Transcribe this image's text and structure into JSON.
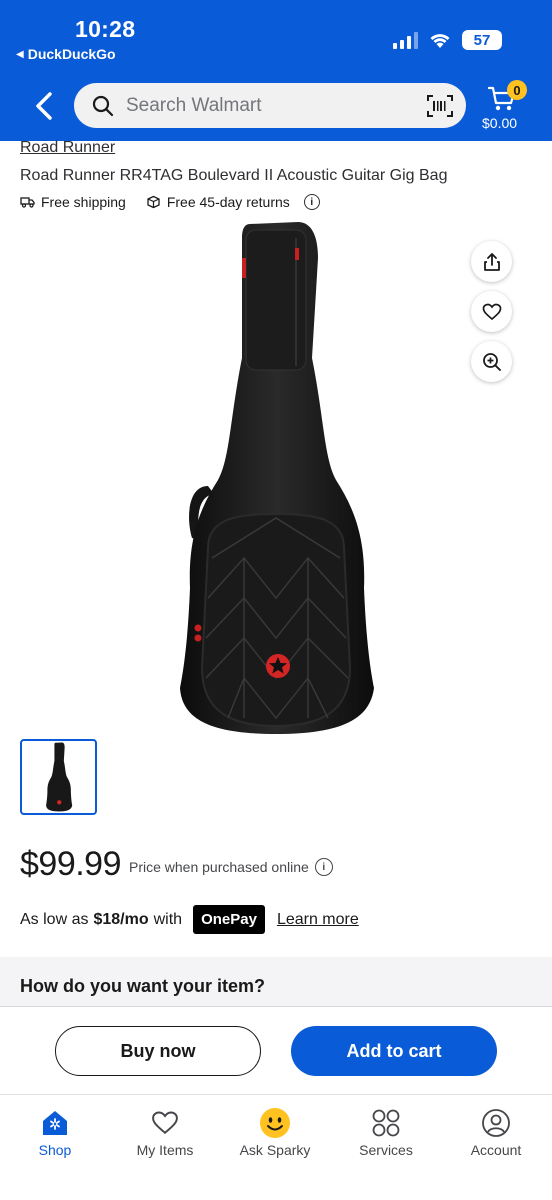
{
  "status_bar": {
    "time": "10:28",
    "back_app": "DuckDuckGo",
    "battery": "57"
  },
  "header": {
    "search_placeholder": "Search Walmart",
    "cart_count": "0",
    "cart_total": "$0.00"
  },
  "product": {
    "brand": "Road Runner",
    "title": "Road Runner RR4TAG Boulevard II Acoustic Guitar Gig Bag",
    "perks": [
      "Free shipping",
      "Free 45-day returns"
    ],
    "price": "$99.99",
    "price_note": "Price when purchased online",
    "paylater_prefix": "As low as",
    "paylater_amount": "$18/mo",
    "paylater_suffix": "with",
    "onepay": "OnePay",
    "learn_more": "Learn more"
  },
  "fulfillment": {
    "title": "How do you want your item?"
  },
  "actions": {
    "buy_now": "Buy now",
    "add_to_cart": "Add to cart"
  },
  "tabs": [
    {
      "label": "Shop",
      "icon": "walmart-spark-icon",
      "active": true
    },
    {
      "label": "My Items",
      "icon": "heart-icon"
    },
    {
      "label": "Ask Sparky",
      "icon": "sparky-icon"
    },
    {
      "label": "Services",
      "icon": "services-grid-icon"
    },
    {
      "label": "Account",
      "icon": "account-icon"
    }
  ],
  "colors": {
    "brand_blue": "#0a5bd7",
    "accent_yellow": "#ffc220"
  }
}
